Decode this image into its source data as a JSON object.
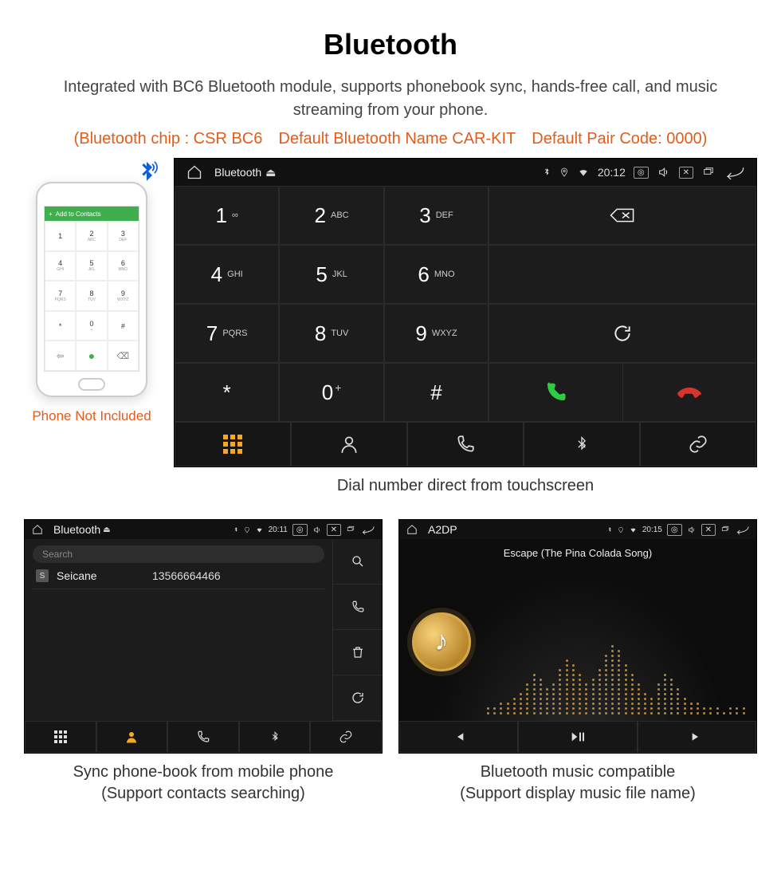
{
  "header": {
    "title": "Bluetooth",
    "subtitle": "Integrated with BC6 Bluetooth module, supports phonebook sync, hands-free call, and music streaming from your phone.",
    "specs": "(Bluetooth chip : CSR BC6 Default Bluetooth Name CAR-KIT Default Pair Code: 0000)"
  },
  "phone_mock": {
    "header_label": "Add to Contacts",
    "keys": [
      {
        "d": "1",
        "s": ""
      },
      {
        "d": "2",
        "s": "ABC"
      },
      {
        "d": "3",
        "s": "DEF"
      },
      {
        "d": "4",
        "s": "GHI"
      },
      {
        "d": "5",
        "s": "JKL"
      },
      {
        "d": "6",
        "s": "MNO"
      },
      {
        "d": "7",
        "s": "PQRS"
      },
      {
        "d": "8",
        "s": "TUV"
      },
      {
        "d": "9",
        "s": "WXYZ"
      },
      {
        "d": "*",
        "s": ""
      },
      {
        "d": "0",
        "s": "+"
      },
      {
        "d": "#",
        "s": ""
      }
    ],
    "caption": "Phone Not Included"
  },
  "dialer": {
    "status": {
      "app": "Bluetooth",
      "time": "20:12"
    },
    "keys": [
      {
        "d": "1",
        "s": "∞"
      },
      {
        "d": "2",
        "s": "ABC"
      },
      {
        "d": "3",
        "s": "DEF"
      },
      {
        "d": "4",
        "s": "GHI"
      },
      {
        "d": "5",
        "s": "JKL"
      },
      {
        "d": "6",
        "s": "MNO"
      },
      {
        "d": "7",
        "s": "PQRS"
      },
      {
        "d": "8",
        "s": "TUV"
      },
      {
        "d": "9",
        "s": "WXYZ"
      },
      {
        "d": "*",
        "s": ""
      },
      {
        "d": "0",
        "s": "+"
      },
      {
        "d": "#",
        "s": ""
      }
    ],
    "caption": "Dial number direct from touchscreen"
  },
  "contacts": {
    "status": {
      "app": "Bluetooth",
      "time": "20:11"
    },
    "search_placeholder": "Search",
    "items": [
      {
        "initial": "S",
        "name": "Seicane",
        "number": "13566664466"
      }
    ],
    "caption_line1": "Sync phone-book from mobile phone",
    "caption_line2": "(Support contacts searching)"
  },
  "music": {
    "status": {
      "app": "A2DP",
      "time": "20:15"
    },
    "track": "Escape (The Pina Colada Song)",
    "caption_line1": "Bluetooth music compatible",
    "caption_line2": "(Support display music file name)"
  }
}
